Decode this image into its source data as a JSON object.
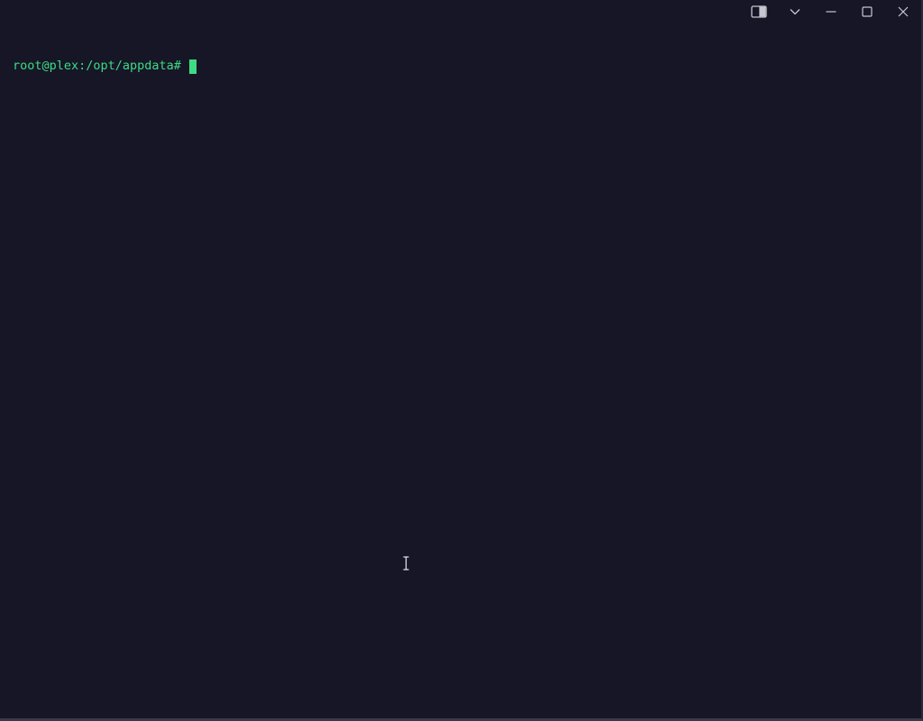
{
  "window": {
    "controls": [
      {
        "name": "pane-toggle-icon"
      },
      {
        "name": "chevron-down-icon"
      },
      {
        "name": "minimize-icon"
      },
      {
        "name": "maximize-icon"
      },
      {
        "name": "close-icon"
      }
    ]
  },
  "terminal": {
    "prompt": "root@plex:/opt/appdata#",
    "input": ""
  },
  "colors": {
    "background": "#161627",
    "prompt": "#3ddc84",
    "cursor": "#3ddc84"
  }
}
